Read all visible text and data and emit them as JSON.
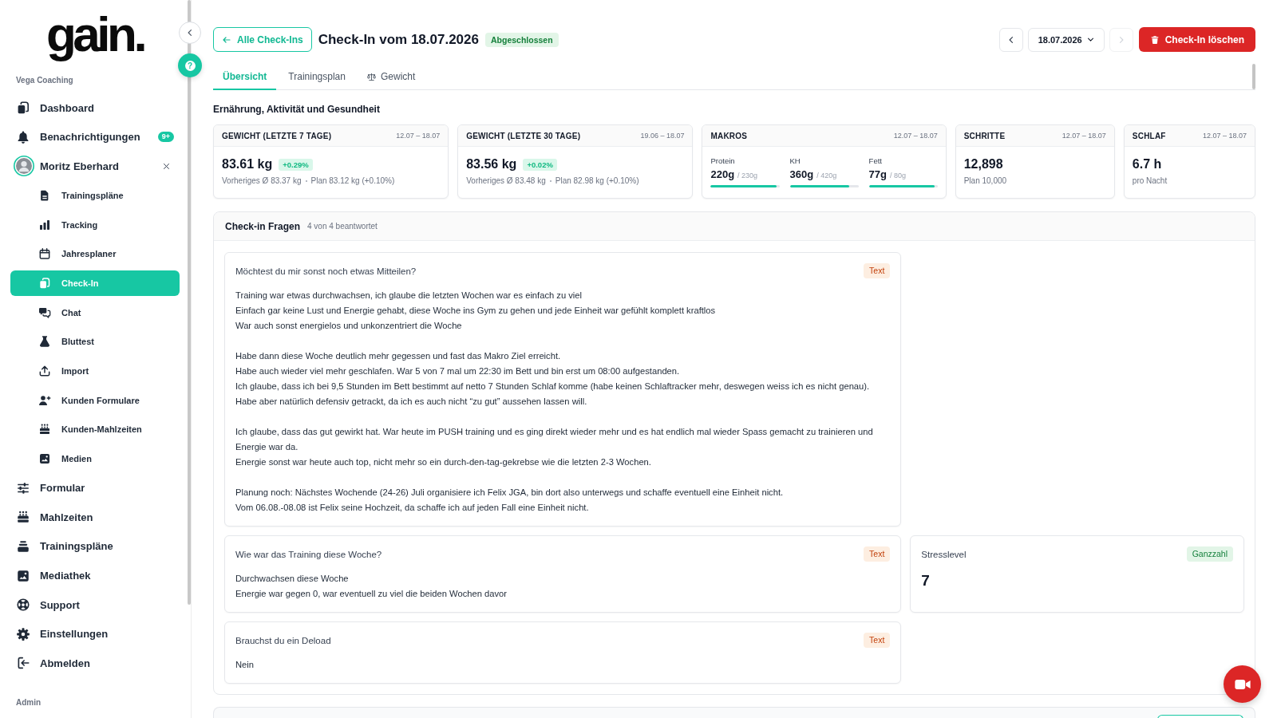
{
  "sidebar": {
    "logo": "gain.",
    "org": "Vega Coaching",
    "items": [
      {
        "kind": "link",
        "label": "Dashboard",
        "selected": false
      },
      {
        "kind": "link",
        "label": "Benachrichtigungen",
        "badge": "9+",
        "selected": false
      },
      {
        "kind": "client",
        "label": "Moritz Eberhard",
        "selected": false,
        "children": [
          {
            "label": "Trainingspläne",
            "selected": false
          },
          {
            "label": "Tracking",
            "selected": false
          },
          {
            "label": "Jahresplaner",
            "selected": false
          },
          {
            "label": "Check-In",
            "selected": true
          },
          {
            "label": "Chat",
            "selected": false
          },
          {
            "label": "Bluttest",
            "selected": false
          },
          {
            "label": "Import",
            "selected": false
          },
          {
            "label": "Kunden Formulare",
            "selected": false
          },
          {
            "label": "Kunden-Mahlzeiten",
            "selected": false
          },
          {
            "label": "Medien",
            "selected": false
          }
        ]
      },
      {
        "kind": "link",
        "label": "Formular",
        "selected": false
      },
      {
        "kind": "link",
        "label": "Mahlzeiten",
        "selected": false
      },
      {
        "kind": "link",
        "label": "Trainingspläne",
        "selected": false
      },
      {
        "kind": "link",
        "label": "Mediathek",
        "selected": false
      },
      {
        "kind": "link",
        "label": "Support",
        "selected": false
      },
      {
        "kind": "link",
        "label": "Einstellungen",
        "selected": false
      },
      {
        "kind": "link",
        "label": "Abmelden",
        "selected": false
      }
    ],
    "section": "Admin"
  },
  "help_button": "?",
  "header": {
    "back_button": "Alle Check-Ins",
    "title": "Check-In vom 18.07.2026",
    "status": "Abgeschlossen",
    "prev_button": {
      "disabled": false
    },
    "date_select": {
      "value": "18.07.2026"
    },
    "next_button": {
      "disabled": true
    },
    "delete_button": "Check-In löschen"
  },
  "tabs": [
    {
      "label": "Übersicht",
      "selected": true
    },
    {
      "label": "Trainingsplan",
      "selected": false
    },
    {
      "label": "Gewicht",
      "selected": false
    }
  ],
  "overview": {
    "title": "Ernährung, Aktivität und Gesundheit",
    "cards": [
      {
        "kind": "weight",
        "title": "GEWICHT (LETZTE 7 TAGE)",
        "range": "12.07 – 18.07",
        "value": "83.61 kg",
        "change": "+0.29%",
        "details": [
          "Vorheriges Ø 83.37 kg",
          "Plan 83.12 kg (+0.10%)"
        ]
      },
      {
        "kind": "weight",
        "title": "GEWICHT (LETZTE 30 TAGE)",
        "range": "19.06 – 18.07",
        "value": "83.56 kg",
        "change": "+0.02%",
        "details": [
          "Vorheriges Ø 83.48 kg",
          "Plan 82.98 kg (+0.10%)"
        ]
      },
      {
        "kind": "macros",
        "title": "MAKROS",
        "range": "12.07 – 18.07",
        "macros": [
          {
            "label": "Protein",
            "value": "220g",
            "target": "/ 230g",
            "level": 0.96
          },
          {
            "label": "KH",
            "value": "360g",
            "target": "/ 420g",
            "level": 0.86
          },
          {
            "label": "Fett",
            "value": "77g",
            "target": "/ 80g",
            "level": 0.96
          }
        ]
      },
      {
        "kind": "metric",
        "title": "SCHRITTE",
        "range": "12.07 – 18.07",
        "value": "12,898",
        "note": "Plan 10,000"
      },
      {
        "kind": "metric",
        "title": "SCHLAF",
        "range": "12.07 – 18.07",
        "value": "6.7 h",
        "note": "pro Nacht"
      }
    ]
  },
  "checkin": {
    "title": "Check-in Fragen",
    "count": "4 von 4 beantwortet",
    "rows": [
      [
        {
          "kind": "text",
          "question": "Möchtest du mir sonst noch etwas Mitteilen?",
          "type_label": "Text",
          "answer": [
            [
              "Training war etwas durchwachsen, ich glaube die letzten Wochen war es einfach zu viel",
              "Einfach gar keine Lust und Energie gehabt, diese Woche ins Gym zu gehen und jede Einheit war gefühlt komplett kraftlos",
              "War auch sonst energielos und unkonzentriert die Woche"
            ],
            [
              "Habe dann diese Woche deutlich mehr gegessen und fast das Makro Ziel erreicht.",
              "Habe auch wieder viel mehr geschlafen. War 5 von 7 mal um 22:30 im Bett und bin erst um 08:00 aufgestanden.",
              "Ich glaube, dass ich bei 9,5 Stunden im Bett bestimmt auf netto 7 Stunden Schlaf komme (habe keinen Schlaftracker mehr, deswegen weiss ich es nicht genau).",
              "Habe aber natürlich defensiv getrackt, da ich es auch nicht “zu gut” aussehen lassen will."
            ],
            [
              "Ich glaube, dass das gut gewirkt hat. War heute im PUSH training und es ging direkt wieder mehr und es hat endlich mal wieder Spass gemacht zu trainieren und Energie war da.",
              "Energie sonst war heute auch top, nicht mehr so ein durch-den-tag-gekrebse wie die letzten 2-3 Wochen."
            ],
            [
              "Planung noch: Nächstes Wochende (24-26) Juli organisiere ich Felix JGA, bin dort also unterwegs und schaffe eventuell eine Einheit nicht.",
              "Vom 06.08.-08.08 ist Felix seine Hochzeit, da schaffe ich auf jeden Fall eine Einheit nicht."
            ]
          ]
        }
      ],
      [
        {
          "kind": "text",
          "question": "Wie war das Training diese Woche?",
          "type_label": "Text",
          "answer": [
            [
              "Durchwachsen diese Woche",
              "Energie war gegen 0, war eventuell zu viel die beiden Wochen davor"
            ]
          ]
        },
        {
          "kind": "integer",
          "question": "Stresslevel",
          "type_label": "Ganzzahl",
          "answer": "7"
        }
      ],
      [
        {
          "kind": "text",
          "question": "Brauchst du ein Deload",
          "type_label": "Text",
          "answer": [
            [
              "Nein"
            ]
          ]
        }
      ]
    ]
  }
}
